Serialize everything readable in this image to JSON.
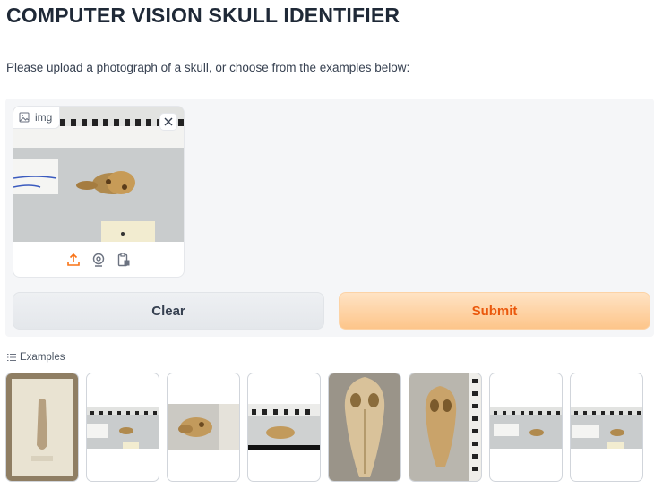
{
  "page": {
    "title": "COMPUTER VISION SKULL IDENTIFIER",
    "subtitle": "Please upload a photograph of a skull, or choose from the examples below:"
  },
  "image_input": {
    "label": "img",
    "label_icon": "image-icon",
    "close_icon": "close-icon",
    "preview_icon": "skull-photo",
    "tools": [
      {
        "name": "upload-icon",
        "color": "#f97316"
      },
      {
        "name": "webcam-icon",
        "color": "#6b7280"
      },
      {
        "name": "clipboard-icon",
        "color": "#6b7280"
      }
    ]
  },
  "buttons": {
    "clear_label": "Clear",
    "submit_label": "Submit",
    "submit_color": "#ea580c"
  },
  "examples": {
    "label": "Examples",
    "label_icon": "list-icon",
    "items": [
      {
        "name": "example-1",
        "kind": "skull-in-display-case"
      },
      {
        "name": "example-2",
        "kind": "skull-with-ruler"
      },
      {
        "name": "example-3",
        "kind": "skull-side-closeup"
      },
      {
        "name": "example-4",
        "kind": "skull-with-ruler"
      },
      {
        "name": "example-5",
        "kind": "skull-top-view"
      },
      {
        "name": "example-6",
        "kind": "skull-top-view-with-ruler"
      },
      {
        "name": "example-7",
        "kind": "skull-with-ruler"
      },
      {
        "name": "example-8",
        "kind": "skull-with-ruler"
      }
    ]
  },
  "colors": {
    "accent": "#f97316",
    "panel_bg": "#f5f6f8"
  }
}
